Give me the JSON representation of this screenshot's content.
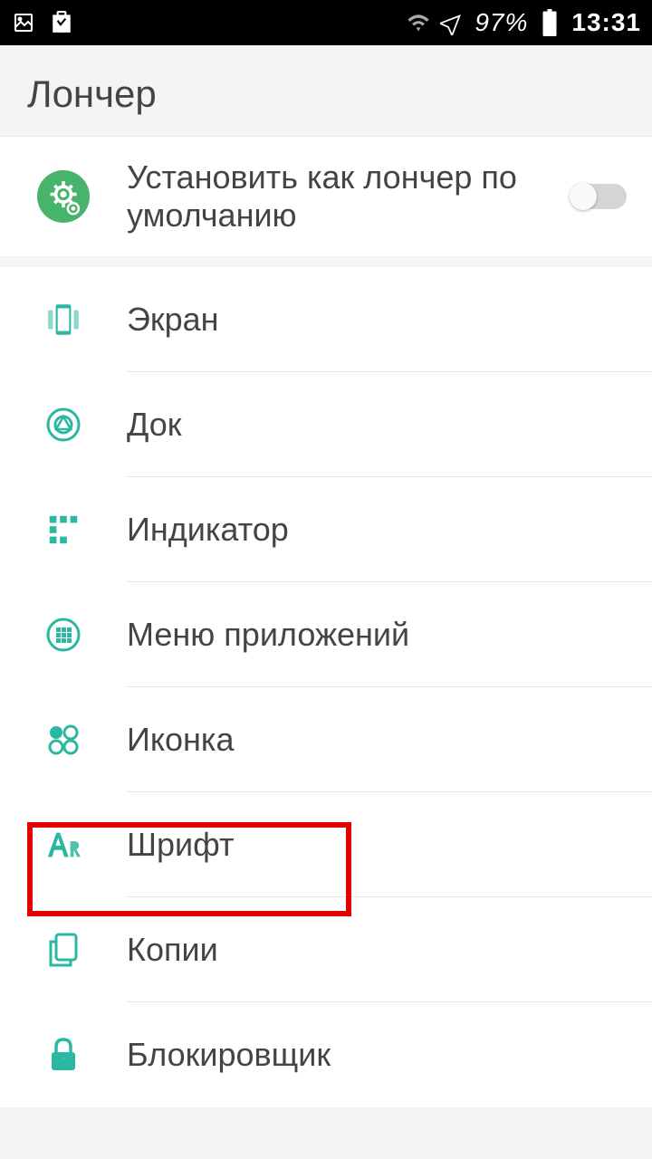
{
  "status": {
    "battery_pct": "97%",
    "time": "13:31"
  },
  "header": {
    "title": "Лончер"
  },
  "section1": {
    "default_launcher": {
      "label": "Установить как лончер по умолчанию"
    }
  },
  "section2": {
    "items": [
      {
        "label": "Экран"
      },
      {
        "label": "Док"
      },
      {
        "label": "Индикатор"
      },
      {
        "label": "Меню приложений"
      },
      {
        "label": "Иконка"
      },
      {
        "label": "Шрифт"
      },
      {
        "label": "Копии"
      },
      {
        "label": "Блокировщик"
      }
    ]
  },
  "colors": {
    "accent": "#2bb8a3"
  }
}
